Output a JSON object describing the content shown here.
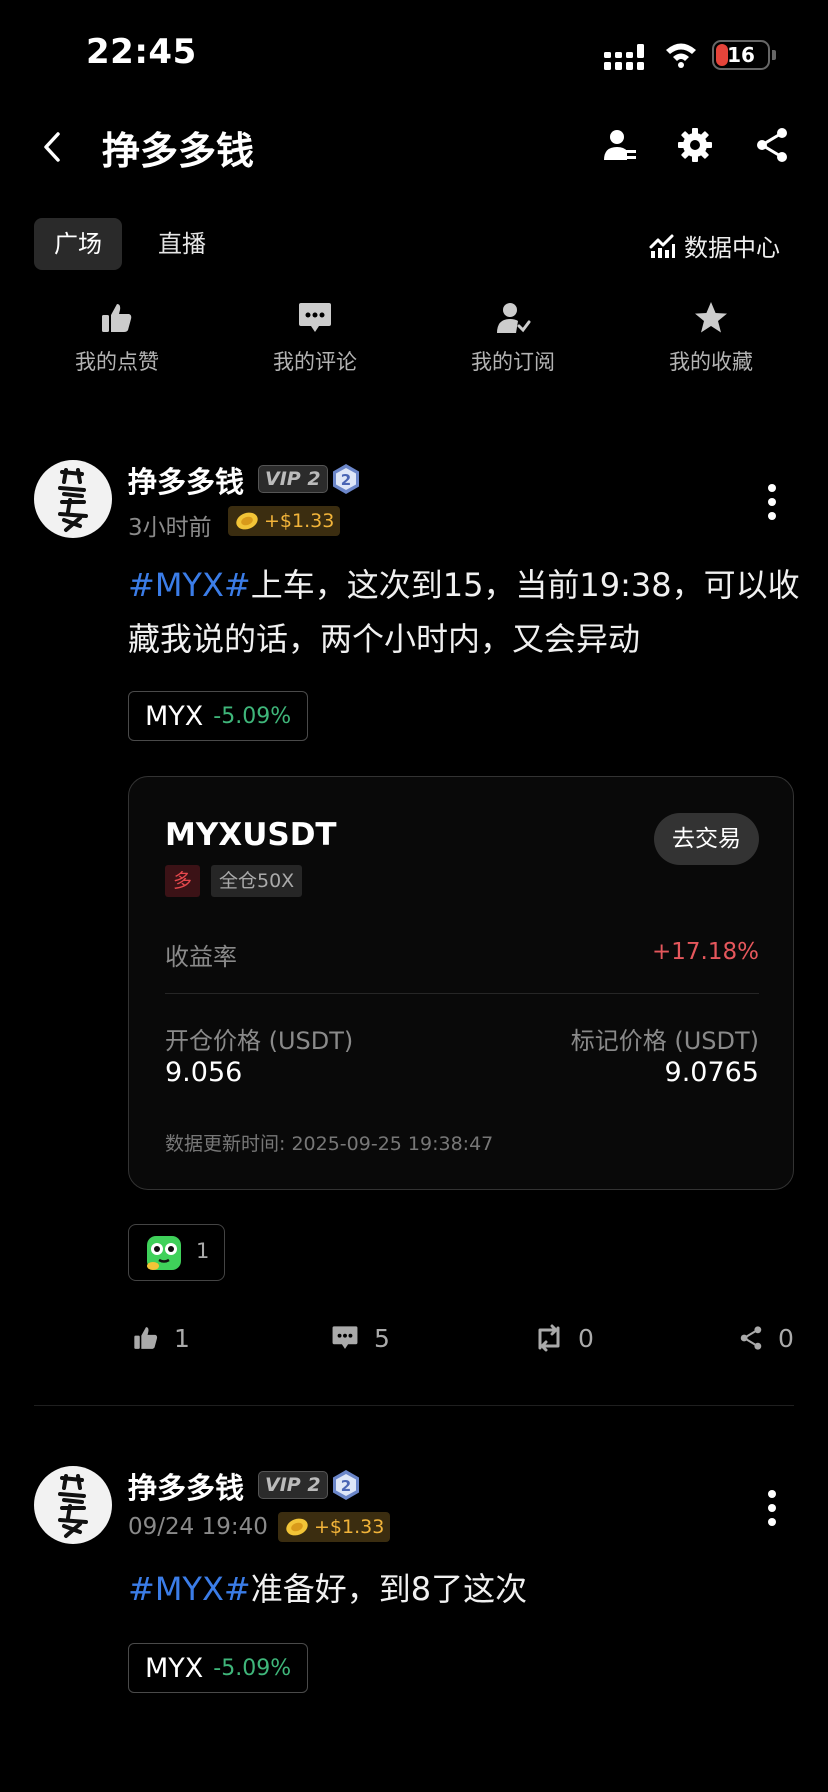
{
  "status_bar": {
    "time": "22:45",
    "battery": "16"
  },
  "header": {
    "title": "挣多多钱"
  },
  "tabs": [
    {
      "label": "广场",
      "active": true
    },
    {
      "label": "直播",
      "active": false
    }
  ],
  "data_center": "数据中心",
  "quick_actions": [
    {
      "label": "我的点赞",
      "icon": "thumbs-up-icon"
    },
    {
      "label": "我的评论",
      "icon": "comment-icon"
    },
    {
      "label": "我的订阅",
      "icon": "subscribe-user-icon"
    },
    {
      "label": "我的收藏",
      "icon": "star-icon"
    }
  ],
  "posts": [
    {
      "username": "挣多多钱",
      "vip": "VIP 2",
      "level": "2",
      "time": "3小时前",
      "reward": "+$1.33",
      "hashtag": "#MYX#",
      "text": "上车，这次到15，当前19:38，可以收藏我说的话，两个小时内，又会异动",
      "ticker": "MYX",
      "ticker_change": "-5.09%",
      "position_card": {
        "symbol": "MYXUSDT",
        "trade_button": "去交易",
        "side": "多",
        "margin": "全仓50X",
        "roi_label": "收益率",
        "roi_value": "+17.18%",
        "open_label": "开仓价格 (USDT)",
        "open_value": "9.056",
        "mark_label": "标记价格 (USDT)",
        "mark_value": "9.0765",
        "update_label": "数据更新时间:",
        "update_time": "2025-09-25 19:38:47"
      },
      "emoji_count": "1",
      "likes": "1",
      "comments": "5",
      "reposts": "0",
      "shares": "0"
    },
    {
      "username": "挣多多钱",
      "vip": "VIP 2",
      "level": "2",
      "time": "09/24 19:40",
      "reward": "+$1.33",
      "hashtag": "#MYX#",
      "text": "准备好，到8了这次",
      "ticker": "MYX",
      "ticker_change": "-5.09%"
    }
  ],
  "colors": {
    "accent_blue": "#3b7de8",
    "up_green": "#3fb67a",
    "down_red": "#e5575c",
    "coin_gold": "#f2b43a"
  }
}
